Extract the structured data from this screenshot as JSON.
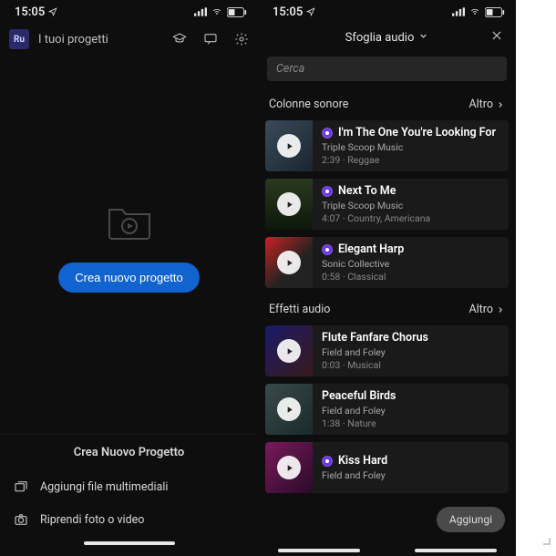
{
  "statusbar": {
    "time": "15:05"
  },
  "left": {
    "app_badge": "Ru",
    "header_title": "I tuoi progetti",
    "primary_button": "Crea nuovo progetto",
    "sheet": {
      "title": "Crea Nuovo Progetto",
      "items": [
        {
          "label": "Aggiungi file multimediali"
        },
        {
          "label": "Riprendi foto o video"
        }
      ]
    }
  },
  "right": {
    "header_title": "Sfoglia audio",
    "search_placeholder": "Cerca",
    "sections": [
      {
        "title": "Colonne sonore",
        "more": "Altro",
        "tracks": [
          {
            "title": "I'm The One You're Looking For",
            "artist": "Triple Scoop Music",
            "meta": "2:39 · Reggae",
            "thumb": "th-a"
          },
          {
            "title": "Next To Me",
            "artist": "Triple Scoop Music",
            "meta": "4:07 · Country, Americana",
            "thumb": "th-b"
          },
          {
            "title": "Elegant Harp",
            "artist": "Sonic Collective",
            "meta": "0:58 · Classical",
            "thumb": "th-c"
          }
        ]
      },
      {
        "title": "Effetti audio",
        "more": "Altro",
        "tracks": [
          {
            "title": "Flute Fanfare Chorus",
            "artist": "Field and Foley",
            "meta": "0:03 · Musical",
            "thumb": "th-d",
            "nodot": true
          },
          {
            "title": "Peaceful Birds",
            "artist": "Field and Foley",
            "meta": "1:38 · Nature",
            "thumb": "th-e",
            "nodot": true
          },
          {
            "title": "Kiss Hard",
            "artist": "Field and Foley",
            "meta": "",
            "thumb": "th-f"
          }
        ]
      }
    ],
    "add_button": "Aggiungi"
  }
}
